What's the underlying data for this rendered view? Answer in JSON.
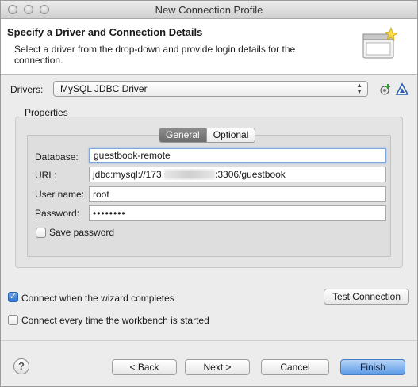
{
  "window": {
    "title": "New Connection Profile"
  },
  "banner": {
    "title": "Specify a Driver and Connection Details",
    "description": "Select a driver from the drop-down and provide login details for the connection."
  },
  "drivers": {
    "label": "Drivers:",
    "selected": "MySQL JDBC Driver"
  },
  "properties": {
    "label": "Properties",
    "tabs": [
      {
        "label": "General",
        "active": true
      },
      {
        "label": "Optional",
        "active": false
      }
    ],
    "fields": {
      "database": {
        "label": "Database:",
        "value": "guestbook-remote"
      },
      "url": {
        "label": "URL:",
        "value_prefix": "jdbc:mysql://173.",
        "value_suffix": ":3306/guestbook"
      },
      "username": {
        "label": "User name:",
        "value": "root"
      },
      "password": {
        "label": "Password:",
        "value": "••••••••"
      }
    },
    "save_password": {
      "label": "Save password",
      "checked": false
    }
  },
  "options": {
    "connect_on_complete": {
      "label": "Connect when the wizard completes",
      "checked": true
    },
    "connect_every_time": {
      "label": "Connect every time the workbench is started",
      "checked": false
    }
  },
  "buttons": {
    "test_connection": "Test Connection",
    "back": "< Back",
    "next": "Next >",
    "cancel": "Cancel",
    "finish": "Finish",
    "help": "?"
  }
}
